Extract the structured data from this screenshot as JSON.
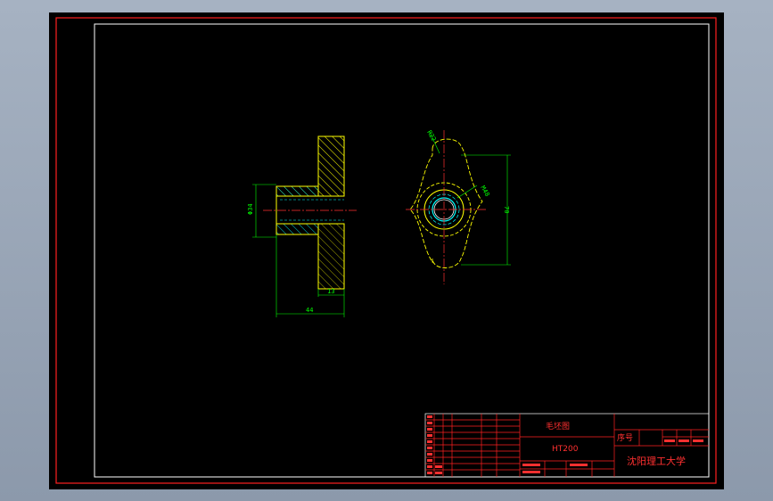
{
  "dimensions": {
    "bore_diameter": "Φ34",
    "flange_thickness": "13",
    "overall_length": "44",
    "fillet_radius": "R22",
    "thread": "M48",
    "width": "70"
  },
  "title_block": {
    "drawing_name": "毛坯图",
    "material": "HT200",
    "school": "沈阳理工大学",
    "serial_label": "序号"
  },
  "colors": {
    "sheet_background": "#000000",
    "border": "#ff2020",
    "frame": "#ffffff",
    "outline": "#ffff00",
    "dimension": "#00ff00",
    "centerline": "#ff3030",
    "hatch": "#00ffff",
    "title_text": "#ff3030"
  }
}
